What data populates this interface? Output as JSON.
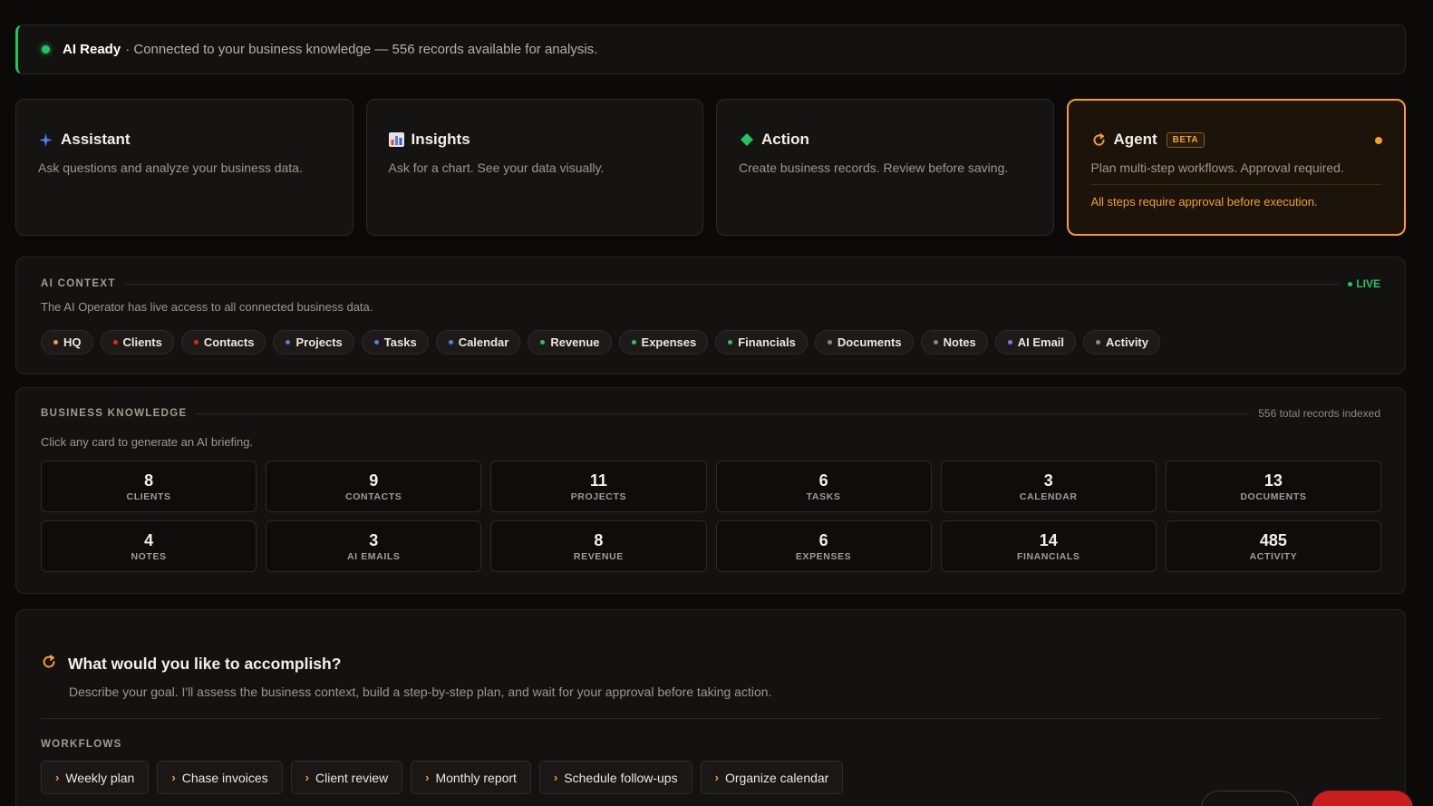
{
  "status": {
    "title": "AI Ready",
    "message": "· Connected to your business knowledge — 556 records available for analysis.",
    "color": "#22c55e"
  },
  "modes": [
    {
      "icon": "sparkle-icon",
      "title": "Assistant",
      "desc": "Ask questions and analyze your business data."
    },
    {
      "icon": "bar-chart-icon",
      "title": "Insights",
      "desc": "Ask for a chart. See your data visually."
    },
    {
      "icon": "diamond-icon",
      "title": "Action",
      "desc": "Create business records. Review before saving."
    },
    {
      "icon": "refresh-icon",
      "title": "Agent",
      "badge": "BETA",
      "desc": "Plan multi-step workflows. Approval required.",
      "note": "All steps require approval before execution.",
      "active": true
    }
  ],
  "context": {
    "label": "AI CONTEXT",
    "live": "LIVE",
    "subtitle": "The AI Operator has live access to all connected business data.",
    "chips": [
      {
        "label": "HQ",
        "color": "#f59e2b"
      },
      {
        "label": "Clients",
        "color": "#dc2626"
      },
      {
        "label": "Contacts",
        "color": "#dc2626"
      },
      {
        "label": "Projects",
        "color": "#4f7df0"
      },
      {
        "label": "Tasks",
        "color": "#4f7df0"
      },
      {
        "label": "Calendar",
        "color": "#4f7df0"
      },
      {
        "label": "Revenue",
        "color": "#22c55e"
      },
      {
        "label": "Expenses",
        "color": "#22c55e"
      },
      {
        "label": "Financials",
        "color": "#22c55e"
      },
      {
        "label": "Documents",
        "color": "#8d877d"
      },
      {
        "label": "Notes",
        "color": "#8d877d"
      },
      {
        "label": "AI Email",
        "color": "#6d7cf5"
      },
      {
        "label": "Activity",
        "color": "#8d877d"
      }
    ]
  },
  "knowledge": {
    "label": "BUSINESS KNOWLEDGE",
    "total": "556 total records indexed",
    "subtitle": "Click any card to generate an AI briefing.",
    "stats": [
      {
        "value": "8",
        "label": "CLIENTS"
      },
      {
        "value": "9",
        "label": "CONTACTS"
      },
      {
        "value": "11",
        "label": "PROJECTS"
      },
      {
        "value": "6",
        "label": "TASKS"
      },
      {
        "value": "3",
        "label": "CALENDAR"
      },
      {
        "value": "13",
        "label": "DOCUMENTS"
      },
      {
        "value": "4",
        "label": "NOTES"
      },
      {
        "value": "3",
        "label": "AI EMAILS"
      },
      {
        "value": "8",
        "label": "REVENUE"
      },
      {
        "value": "6",
        "label": "EXPENSES"
      },
      {
        "value": "14",
        "label": "FINANCIALS"
      },
      {
        "value": "485",
        "label": "ACTIVITY"
      }
    ]
  },
  "goal": {
    "title": "What would you like to accomplish?",
    "desc": "Describe your goal. I'll assess the business context, build a step-by-step plan, and wait for your approval before taking action.",
    "workflows_label": "WORKFLOWS",
    "workflows": [
      "Weekly plan",
      "Chase invoices",
      "Client review",
      "Monthly report",
      "Schedule follow-ups",
      "Organize calendar"
    ]
  }
}
